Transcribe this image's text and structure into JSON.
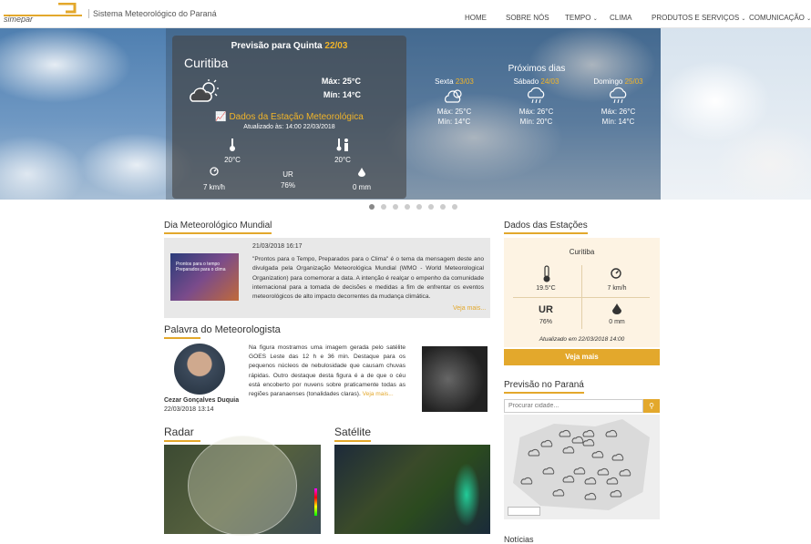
{
  "header": {
    "logo_text": "Sistema Meteorológico do Paraná"
  },
  "nav": [
    {
      "label": "HOME"
    },
    {
      "label": "SOBRE NÓS"
    },
    {
      "label": "TEMPO"
    },
    {
      "label": "CLIMA"
    },
    {
      "label": "PRODUTOS E SERVIÇOS"
    },
    {
      "label": "COMUNICAÇÃO"
    }
  ],
  "hero": {
    "title": "Previsão para Quinta",
    "title_date": "22/03",
    "city": "Curitiba",
    "max": "Máx: 25°C",
    "min": "Mín: 14°C",
    "station": "Dados da Estação Meteorológica",
    "updated": "Atualizado às: 14:00 22/03/2018",
    "temp": "20°C",
    "feels": "20°C",
    "wind": "7 km/h",
    "ur_label": "UR",
    "ur": "76%",
    "rain": "0 mm",
    "next_title": "Próximos dias",
    "days": [
      {
        "name": "Sexta",
        "date": "23/03",
        "max": "Máx: 25°C",
        "min": "Mín: 14°C"
      },
      {
        "name": "Sábado",
        "date": "24/03",
        "max": "Máx: 26°C",
        "min": "Mín: 20°C"
      },
      {
        "name": "Domingo",
        "date": "25/03",
        "max": "Máx: 26°C",
        "min": "Mín: 14°C"
      }
    ]
  },
  "dmm": {
    "title": "Dia Meteorológico Mundial",
    "date": "21/03/2018 16:17",
    "text": "\"Prontos para o Tempo, Preparados para o Clima\" é o tema da mensagem deste ano divulgada pela Organização Meteorológica Mundial (WMO - World Meteorological Organization) para comemorar a data. A intenção é realçar o empenho da comunidade internacional para a tomada de decisões e medidas a fim de enfrentar os eventos meteorológicos de alto impacto decorrentes da mudança climática.",
    "more": "Veja mais...",
    "img_text": "Prontos para o tempo Preparados para o clima"
  },
  "palavra": {
    "title": "Palavra do Meteorologista",
    "name": "Cezar Gonçalves Duquia",
    "date": "22/03/2018 13:14",
    "text": "Na figura mostramos uma imagem gerada pelo satélite GOES Leste das 12 h e 36 min. Destaque para os pequenos núcleos de nebulosidade que causam chuvas rápidas. Outro destaque desta figura é a de que o céu está encoberto por nuvens sobre praticamente todas as regiões paranaenses (tonalidades claras).",
    "more": "Veja mais..."
  },
  "radar": {
    "title": "Radar"
  },
  "satelite": {
    "title": "Satélite"
  },
  "stations": {
    "title": "Dados das Estações",
    "city": "Curitiba",
    "temp": "19.5°C",
    "wind": "7 km/h",
    "ur_label": "UR",
    "ur": "76%",
    "rain": "0 mm",
    "updated": "Atualizado em 22/03/2018 14:00",
    "button": "Veja mais"
  },
  "previsao": {
    "title": "Previsão no Paraná",
    "placeholder": "Procurar cidade..."
  },
  "noticias": {
    "title": "Notícias"
  },
  "colors": {
    "accent": "#e3a82c"
  }
}
